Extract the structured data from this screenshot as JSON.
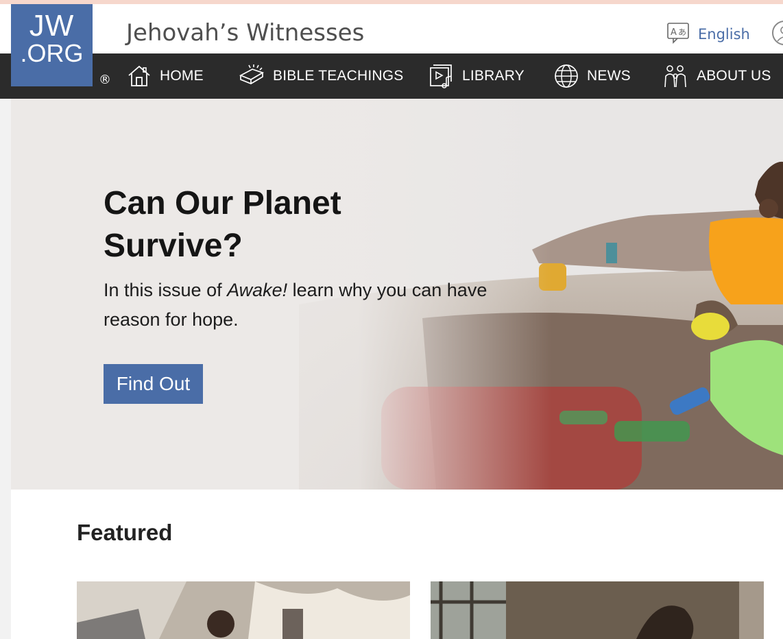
{
  "header": {
    "logo_line1": "JW",
    "logo_line2": ".ORG",
    "registered_mark": "®",
    "site_title": "Jehovah’s Witnesses",
    "language_label": "English",
    "language_icon": "translate-icon",
    "account_icon": "account-icon"
  },
  "nav": {
    "items": [
      {
        "label": "HOME",
        "icon": "home-icon"
      },
      {
        "label": "BIBLE TEACHINGS",
        "icon": "open-bible-icon"
      },
      {
        "label": "LIBRARY",
        "icon": "library-media-icon"
      },
      {
        "label": "NEWS",
        "icon": "globe-icon"
      },
      {
        "label": "ABOUT US",
        "icon": "people-icon"
      }
    ]
  },
  "hero": {
    "title": "Can Our Planet Survive?",
    "subtitle_before": "In this issue of ",
    "subtitle_emphasis": "Awake!",
    "subtitle_after": " learn why you can have reason for hope.",
    "cta_label": "Find Out"
  },
  "featured": {
    "heading": "Featured"
  },
  "colors": {
    "brand_blue": "#4a6da7",
    "nav_background": "#2b2b2b",
    "hero_shirt": "#f7a21b",
    "glove_yellow": "#e8dc3a",
    "trash_bag_green": "#9ee27b"
  }
}
